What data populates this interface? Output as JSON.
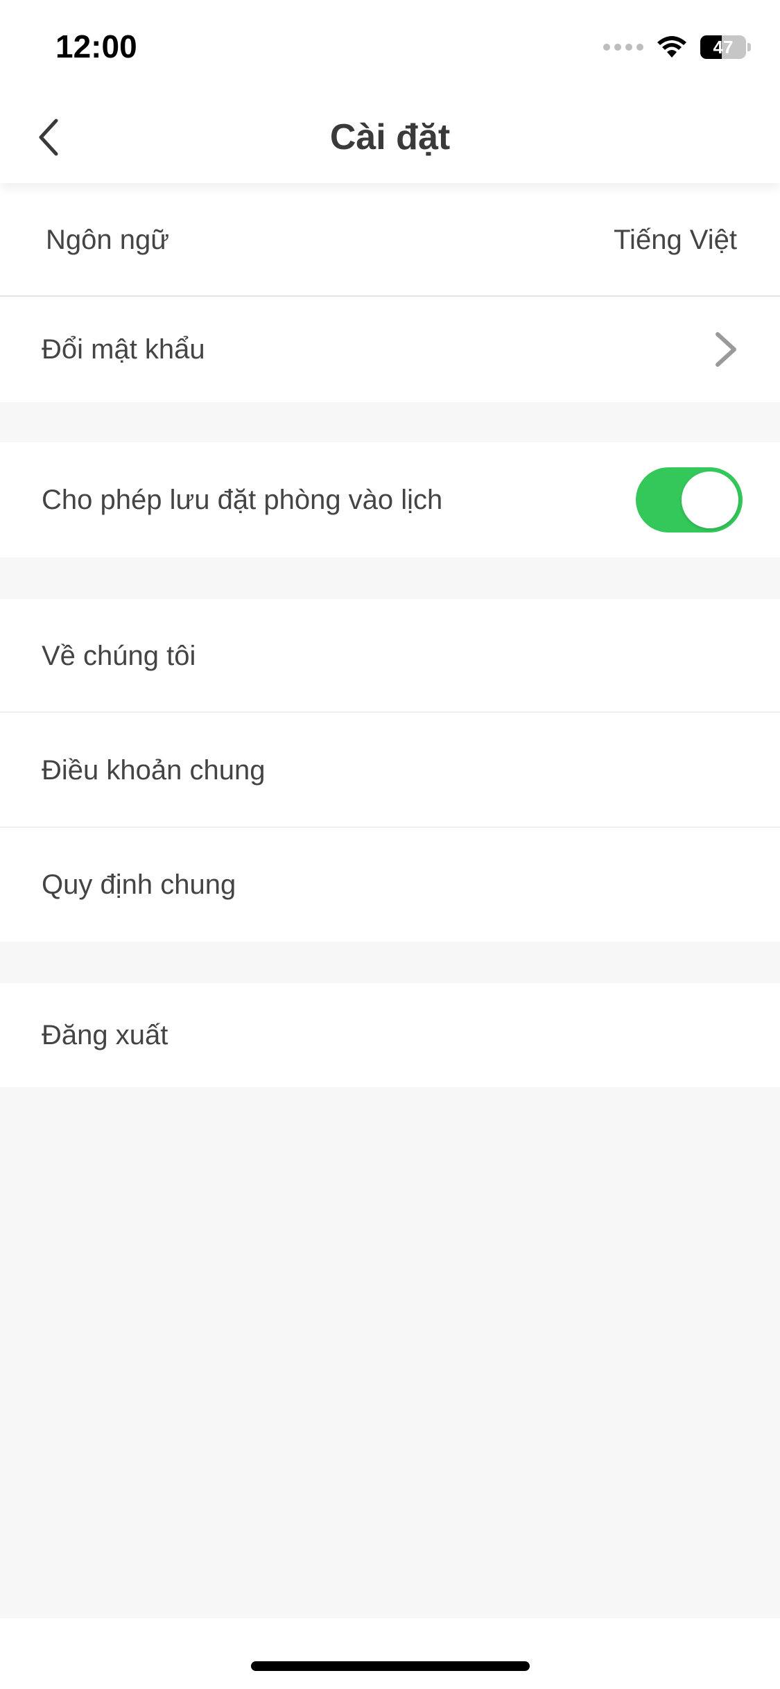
{
  "status_bar": {
    "time": "12:00",
    "battery_level": "47",
    "icons": [
      "signal-dots-icon",
      "wifi-icon",
      "battery-icon"
    ]
  },
  "nav": {
    "title": "Cài đặt",
    "back_icon": "chevron-left-icon"
  },
  "settings": {
    "language": {
      "label": "Ngôn ngữ",
      "value": "Tiếng Việt"
    },
    "change_password": {
      "label": "Đổi mật khẩu",
      "icon": "chevron-right-icon"
    },
    "calendar_toggle": {
      "label": "Cho phép lưu đặt phòng vào lịch",
      "enabled": true,
      "on_color": "#34c759"
    },
    "about_us": {
      "label": "Về chúng tôi"
    },
    "terms": {
      "label": "Điều khoản chung"
    },
    "regulations": {
      "label": "Quy định chung"
    },
    "logout": {
      "label": "Đăng xuất"
    }
  },
  "colors": {
    "background": "#f7f7f7",
    "surface": "#ffffff",
    "text": "#444444",
    "accent_green": "#34c759"
  }
}
